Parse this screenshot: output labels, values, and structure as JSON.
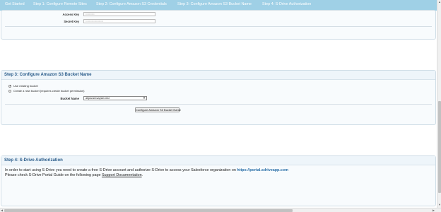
{
  "tabs": [
    {
      "label": "Get Started"
    },
    {
      "label": "Step 1: Configure Remote Sites"
    },
    {
      "label": "Step 2: Configure Amazon S3 Credentials"
    },
    {
      "label": "Step 3: Configure Amazon S3 Bucket Name"
    },
    {
      "label": "Step 4: S-Drive Authorization"
    }
  ],
  "step2": {
    "access_key_label": "Access Key",
    "secret_key_label": "Secret Key",
    "access_key_value": "••••••••••",
    "secret_key_value": "••••••••••••••••••••"
  },
  "step3": {
    "title": "Step 3: Configure Amazon S3 Bucket Name",
    "option_existing": "Use existing bucket",
    "option_new": "Create a new bucket (requires create bucket permission)",
    "bucket_label": "Bucket Name",
    "bucket_value": "allparamsaylar-test",
    "button": "Configure Amazon S3 Bucket Name"
  },
  "step4": {
    "title": "Step 4: S-Drive Authorization",
    "line1_text": "In order to start using S-Drive you need to create a free S-Drive account and authorize S-Drive to access your Salesforce organization on ",
    "line1_link": "https://portal.sdriveapp.com",
    "line2_text": "Please check S-Drive Portal Guide on the following page ",
    "line2_link": "Support Documentation",
    "line2_end": "."
  }
}
